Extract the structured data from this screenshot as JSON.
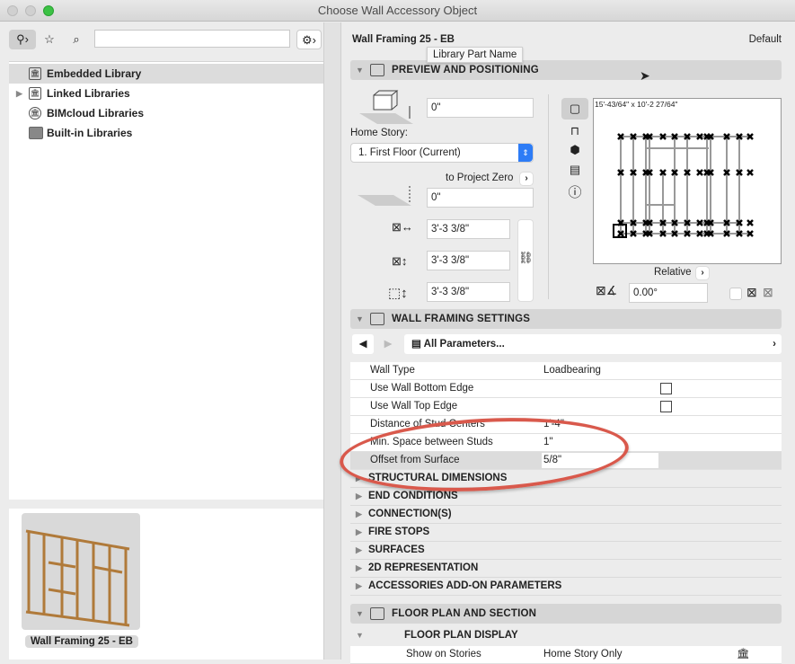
{
  "window": {
    "title": "Choose Wall Accessory Object"
  },
  "left": {
    "search_value": "",
    "tree": [
      {
        "label": "Embedded Library",
        "icon": "library-file-icon",
        "selected": true
      },
      {
        "label": "Linked Libraries",
        "icon": "library-folder-icon",
        "expandable": true
      },
      {
        "label": "BIMcloud Libraries",
        "icon": "bimcloud-icon"
      },
      {
        "label": "Built-in Libraries",
        "icon": "folder-icon"
      }
    ],
    "preview_name": "Wall Framing 25 - EB"
  },
  "right": {
    "object_name": "Wall Framing 25 - EB",
    "default_label": "Default",
    "tooltip": "Library Part Name",
    "preview": {
      "title": "PREVIEW AND POSITIONING",
      "elevation": "0\"",
      "home_story_label": "Home Story:",
      "home_story_value": "1. First Floor (Current)",
      "to_project_zero": "to Project Zero",
      "project_zero_value": "0\"",
      "width": "3'-3 3/8\"",
      "depth": "3'-3 3/8\"",
      "height": "3'-3 3/8\"",
      "dimensions": "15'-43/64\" x 10'-2 27/64\"",
      "relative": "Relative",
      "angle": "0.00°"
    },
    "settings": {
      "title": "WALL FRAMING SETTINGS",
      "params_dropdown": "All Parameters...",
      "rows": [
        {
          "name": "Wall Type",
          "value": "Loadbearing"
        },
        {
          "name": "Use Wall Bottom Edge",
          "checkbox": false
        },
        {
          "name": "Use Wall Top Edge",
          "checkbox": false
        },
        {
          "name": "Distance of Stud Centers",
          "value": "1'-4\""
        },
        {
          "name": "Min. Space between Studs",
          "value": "1\""
        },
        {
          "name": "Offset from Surface",
          "value": "5/8\"",
          "selected": true
        }
      ],
      "groups": [
        "STRUCTURAL DIMENSIONS",
        "END CONDITIONS",
        "CONNECTION(S)",
        "FIRE STOPS",
        "SURFACES",
        "2D REPRESENTATION",
        "ACCESSORIES ADD-ON PARAMETERS"
      ]
    },
    "floorplan": {
      "title": "FLOOR PLAN AND SECTION",
      "subgroup": "FLOOR PLAN DISPLAY",
      "row": {
        "name": "Show on Stories",
        "value": "Home Story Only"
      }
    }
  }
}
